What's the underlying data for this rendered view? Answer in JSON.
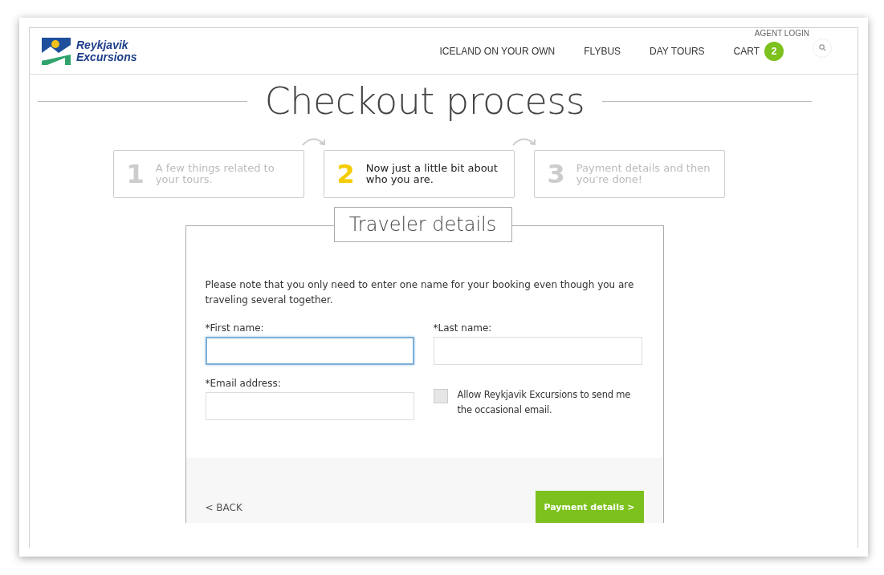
{
  "header": {
    "logo_line1": "Reykjavik",
    "logo_line2": "Excursions",
    "agent_login": "AGENT LOGIN",
    "nav": [
      {
        "label": "ICELAND ON YOUR OWN"
      },
      {
        "label": "FLYBUS"
      },
      {
        "label": "DAY TOURS"
      },
      {
        "label": "CART",
        "badge": "2"
      }
    ]
  },
  "title": "Checkout process",
  "steps": [
    {
      "number": "1",
      "text": "A few things related to your tours.",
      "selected": false
    },
    {
      "number": "2",
      "text": "Now just a little bit about who you are.",
      "selected": true
    },
    {
      "number": "3",
      "text": "Payment details and then you're done!",
      "selected": false
    }
  ],
  "form": {
    "legend": "Traveler details",
    "note": "Please note that you only need to enter one name for your booking even though you are traveling several together.",
    "fields": [
      {
        "label": "*First name:",
        "focused": true
      },
      {
        "label": "*Last name:",
        "focused": false
      },
      {
        "label": "*Email address:",
        "focused": false
      }
    ],
    "optin": {
      "label": "Allow Reykjavik Excursions to send me the occasional email.",
      "checked": false
    },
    "back": "< BACK",
    "next": "Payment details >"
  }
}
